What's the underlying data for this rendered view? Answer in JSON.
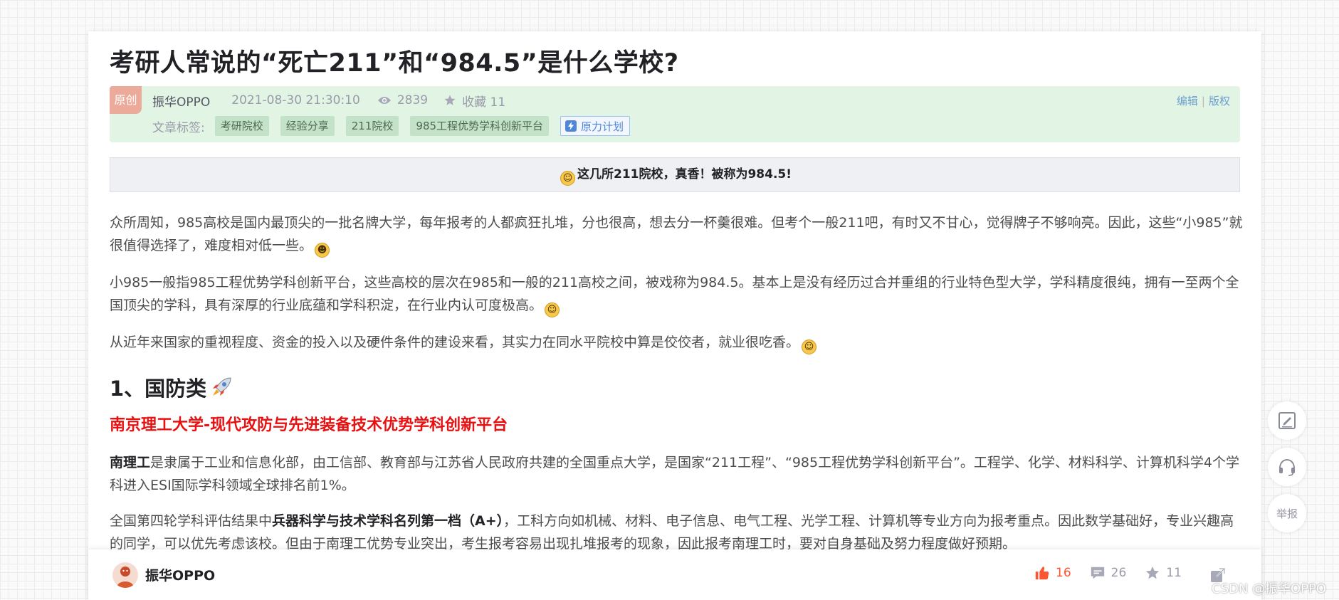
{
  "article": {
    "title": "考研人常说的“死亡211”和“984.5”是什么学校?",
    "meta": {
      "badge": "原创",
      "author": "振华OPPO",
      "date": "2021-08-30 21:30:10",
      "views": "2839",
      "favorites": "收藏 11",
      "edit": "编辑",
      "copyright": "版权",
      "tags_label": "文章标签:",
      "tags": [
        "考研院校",
        "经验分享",
        "211院校",
        "985工程优势学科创新平台"
      ],
      "special_tag": "原力计划"
    },
    "summary": "这几所211院校，真香！被称为984.5!",
    "paragraphs": {
      "p1": "众所周知，985高校是国内最顶尖的一批名牌大学，每年报考的人都疯狂扎堆，分也很高，想去分一杯羹很难。但考个一般211吧，有时又不甘心，觉得牌子不够响亮。因此，这些“小985”就很值得选择了，难度相对低一些。",
      "p2": "小985一般指985工程优势学科创新平台，这些高校的层次在985和一般的211高校之间，被戏称为984.5。基本上是没有经历过合并重组的行业特色型大学，学科精度很纯，拥有一至两个全国顶尖的学科，具有深厚的行业底蕴和学科积淀，在行业内认可度极高。",
      "p3": "从近年来国家的重视程度、资金的投入以及硬件条件的建设来看，其实力在同水平院校中算是佼佼者，就业很吃香。",
      "p4_bold": "南理工",
      "p4_rest": "是隶属于工业和信息化部，由工信部、教育部与江苏省人民政府共建的全国重点大学，是国家“211工程”、“985工程优势学科创新平台”。工程学、化学、材料科学、计算机科学4个学科进入ESI国际学科领域全球排名前1%。",
      "p5_a": "全国第四轮学科评估结果中",
      "p5_bold": "兵器科学与技术学科名列第一档（A+）",
      "p5_rest": "，工科方向如机械、材料、电子信息、电气工程、光学工程、计算机等专业方向为报考重点。因此数学基础好，专业兴趣高的同学，可以优先考虑该校。但由于南理工优势专业突出，考生报考容易出现扎堆报考的现象，因此报考南理工时，要对自身基础及努力程度做好预期。"
    },
    "section_heading": "1、国防类",
    "red_heading": "南京理工大学-现代攻防与先进装备技术优势学科创新平台"
  },
  "bottom_bar": {
    "author": "振华OPPO",
    "likes": "16",
    "comments": "26",
    "favorites": "11"
  },
  "side": {
    "report": "举报"
  },
  "watermark": "CSDN @振华OPPO",
  "icons": {
    "views": "eye-icon",
    "favorites": "star-icon",
    "like": "thumb-up-icon",
    "comment": "comment-icon",
    "share": "share-icon",
    "edit": "edit-icon",
    "service": "headset-icon"
  },
  "colors": {
    "meta_bg": "#e2f4e3",
    "tag_bg": "#c4e2c7",
    "red_heading": "#e81010",
    "like": "#fc5531",
    "link": "#6b9fd0"
  }
}
